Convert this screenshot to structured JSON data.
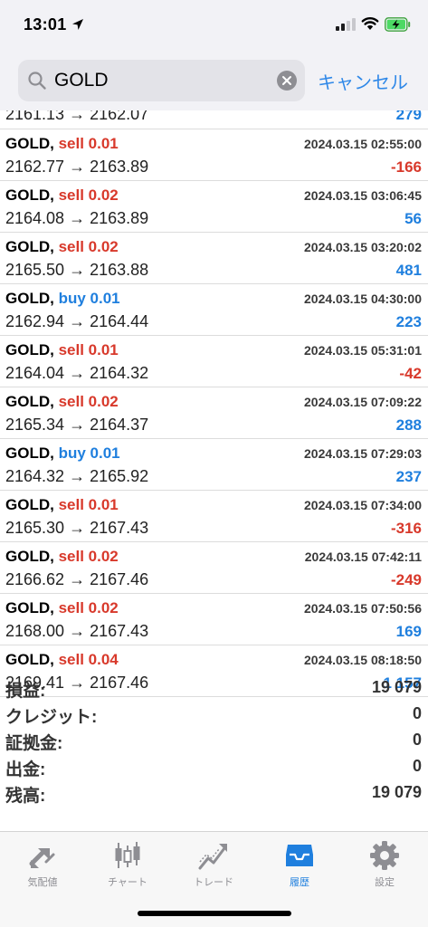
{
  "status_bar": {
    "time": "13:01"
  },
  "search": {
    "query": "GOLD",
    "cancel_label": "キャンセル"
  },
  "partial_row": {
    "prices": "2161.13 → 2162.07",
    "profit": "279"
  },
  "trades": [
    {
      "symbol": "GOLD,",
      "side": "sell",
      "volume": "sell 0.01",
      "time": "2024.03.15 02:55:00",
      "prices": "2162.77 → 2163.89",
      "profit": "-166"
    },
    {
      "symbol": "GOLD,",
      "side": "sell",
      "volume": "sell 0.02",
      "time": "2024.03.15 03:06:45",
      "prices": "2164.08 → 2163.89",
      "profit": "56"
    },
    {
      "symbol": "GOLD,",
      "side": "sell",
      "volume": "sell 0.02",
      "time": "2024.03.15 03:20:02",
      "prices": "2165.50 → 2163.88",
      "profit": "481"
    },
    {
      "symbol": "GOLD,",
      "side": "buy",
      "volume": "buy 0.01",
      "time": "2024.03.15 04:30:00",
      "prices": "2162.94 → 2164.44",
      "profit": "223"
    },
    {
      "symbol": "GOLD,",
      "side": "sell",
      "volume": "sell 0.01",
      "time": "2024.03.15 05:31:01",
      "prices": "2164.04 → 2164.32",
      "profit": "-42"
    },
    {
      "symbol": "GOLD,",
      "side": "sell",
      "volume": "sell 0.02",
      "time": "2024.03.15 07:09:22",
      "prices": "2165.34 → 2164.37",
      "profit": "288"
    },
    {
      "symbol": "GOLD,",
      "side": "buy",
      "volume": "buy 0.01",
      "time": "2024.03.15 07:29:03",
      "prices": "2164.32 → 2165.92",
      "profit": "237"
    },
    {
      "symbol": "GOLD,",
      "side": "sell",
      "volume": "sell 0.01",
      "time": "2024.03.15 07:34:00",
      "prices": "2165.30 → 2167.43",
      "profit": "-316"
    },
    {
      "symbol": "GOLD,",
      "side": "sell",
      "volume": "sell 0.02",
      "time": "2024.03.15 07:42:11",
      "prices": "2166.62 → 2167.46",
      "profit": "-249"
    },
    {
      "symbol": "GOLD,",
      "side": "sell",
      "volume": "sell 0.02",
      "time": "2024.03.15 07:50:56",
      "prices": "2168.00 → 2167.43",
      "profit": "169"
    },
    {
      "symbol": "GOLD,",
      "side": "sell",
      "volume": "sell 0.04",
      "time": "2024.03.15 08:18:50",
      "prices": "2169.41 → 2167.46",
      "profit": "1 157"
    }
  ],
  "summary": [
    {
      "label": "損益:",
      "value": "19 079"
    },
    {
      "label": "クレジット:",
      "value": "0"
    },
    {
      "label": "証拠金:",
      "value": "0"
    },
    {
      "label": "出金:",
      "value": "0"
    },
    {
      "label": "残高:",
      "value": "19 079"
    }
  ],
  "tabs": [
    {
      "label": "気配値",
      "icon": "quotes-arrows-icon",
      "active": false
    },
    {
      "label": "チャート",
      "icon": "chart-candles-icon",
      "active": false
    },
    {
      "label": "トレード",
      "icon": "trade-chart-icon",
      "active": false
    },
    {
      "label": "履歴",
      "icon": "history-inbox-icon",
      "active": true
    },
    {
      "label": "設定",
      "icon": "gear-icon",
      "active": false
    }
  ],
  "colors": {
    "sell": "#d8392b",
    "buy": "#1f7fde",
    "profit_positive": "#1f7fde",
    "profit_negative": "#d8392b",
    "accent": "#2f88e8"
  }
}
